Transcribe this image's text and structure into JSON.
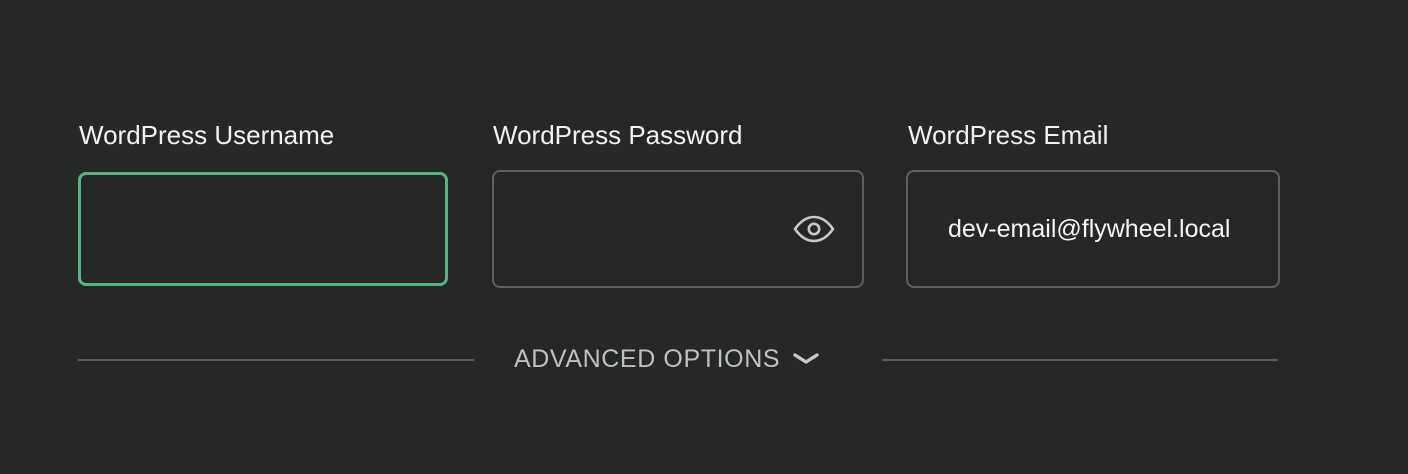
{
  "form": {
    "username": {
      "label": "WordPress Username",
      "value": "",
      "placeholder": ""
    },
    "password": {
      "label": "WordPress Password",
      "value": "",
      "placeholder": "",
      "reveal_icon": "eye-icon"
    },
    "email": {
      "label": "WordPress Email",
      "value": "dev-email@flywheel.local",
      "placeholder": ""
    }
  },
  "advanced": {
    "label": "ADVANCED OPTIONS",
    "icon": "chevron-down-icon"
  },
  "colors": {
    "background": "#262828",
    "focus_border": "#55b582",
    "input_border": "#5e6060",
    "label_text": "#f2f2f2",
    "muted_text": "#bfc1c1",
    "divider": "#5b5d5d"
  }
}
